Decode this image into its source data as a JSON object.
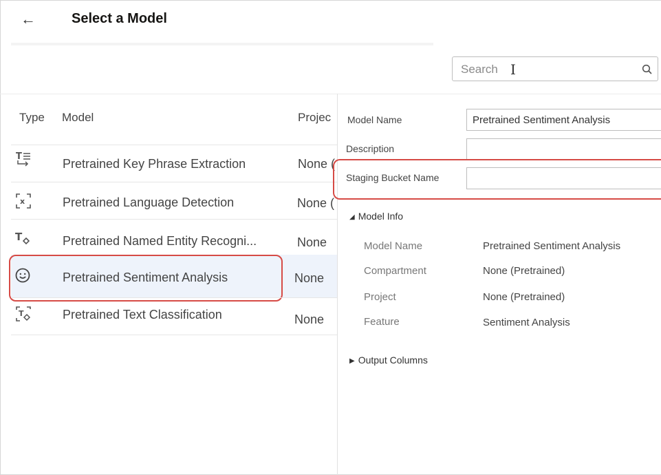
{
  "header": {
    "title": "Select a Model",
    "back_icon": "arrow-left-icon"
  },
  "search": {
    "placeholder": "Search"
  },
  "table": {
    "columns": {
      "type": "Type",
      "model": "Model",
      "project": "Projec"
    },
    "rows": [
      {
        "icon": "key-phrase-icon",
        "name": "Pretrained Key Phrase Extraction",
        "project": "None ("
      },
      {
        "icon": "language-detection-icon",
        "name": "Pretrained Language Detection",
        "project": "None ("
      },
      {
        "icon": "named-entity-icon",
        "name": "Pretrained Named Entity Recogni...",
        "project": "None"
      },
      {
        "icon": "smiley-icon",
        "name": "Pretrained Sentiment Analysis",
        "project": "None"
      },
      {
        "icon": "text-classification-icon",
        "name": "Pretrained Text Classification",
        "project": "None"
      }
    ],
    "selected_index": 3
  },
  "details": {
    "model_name_label": "Model Name",
    "model_name_value": "Pretrained Sentiment Analysis",
    "description_label": "Description",
    "description_value": "",
    "staging_label": "Staging Bucket Name",
    "staging_value": "",
    "model_info_header": "Model Info",
    "model_info": {
      "model_name_k": "Model Name",
      "model_name_v": "Pretrained Sentiment Analysis",
      "compartment_k": "Compartment",
      "compartment_v": "None (Pretrained)",
      "project_k": "Project",
      "project_v": "None (Pretrained)",
      "feature_k": "Feature",
      "feature_v": "Sentiment Analysis"
    },
    "output_columns_header": "Output Columns"
  },
  "colors": {
    "highlight": "#d64a45",
    "selected_row": "#eef3fb"
  }
}
